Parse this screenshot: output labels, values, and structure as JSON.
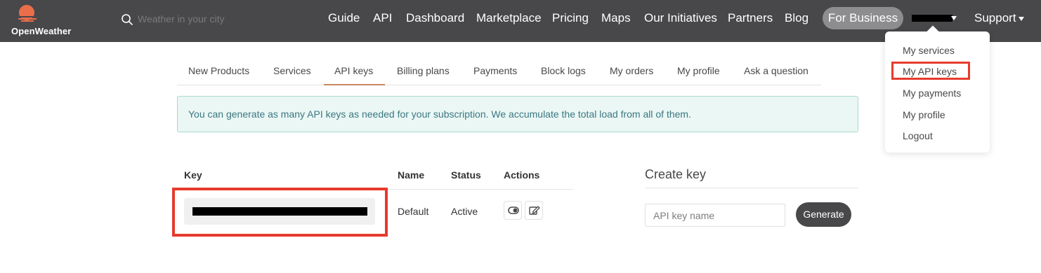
{
  "brand": {
    "logo_text": "OpenWeather",
    "accent": "#eb6e4b",
    "nav_bg": "#48484a"
  },
  "search": {
    "placeholder": "Weather in your city",
    "value": ""
  },
  "nav": {
    "guide": "Guide",
    "api": "API",
    "dashboard": "Dashboard",
    "marketplace": "Marketplace",
    "pricing": "Pricing",
    "maps": "Maps",
    "initiatives": "Our Initiatives",
    "partners": "Partners",
    "blog": "Blog",
    "business": "For Business",
    "support": "Support"
  },
  "user_dropdown": {
    "items": [
      "My services",
      "My API keys",
      "My payments",
      "My profile",
      "Logout"
    ],
    "highlighted_item": "My API keys",
    "highlight_color": "#e63b2e"
  },
  "subnav": {
    "tabs": [
      "New Products",
      "Services",
      "API keys",
      "Billing plans",
      "Payments",
      "Block logs",
      "My orders",
      "My profile",
      "Ask a question"
    ],
    "active_tab": "API keys"
  },
  "alert": {
    "text": "You can generate as many API keys as needed for your subscription. We accumulate the total load from all of them."
  },
  "keys_table": {
    "headers": {
      "key": "Key",
      "name": "Name",
      "status": "Status",
      "actions": "Actions"
    },
    "rows": [
      {
        "name": "Default",
        "status": "Active"
      }
    ]
  },
  "create_key": {
    "title": "Create key",
    "input_placeholder": "API key name",
    "button_label": "Generate"
  }
}
